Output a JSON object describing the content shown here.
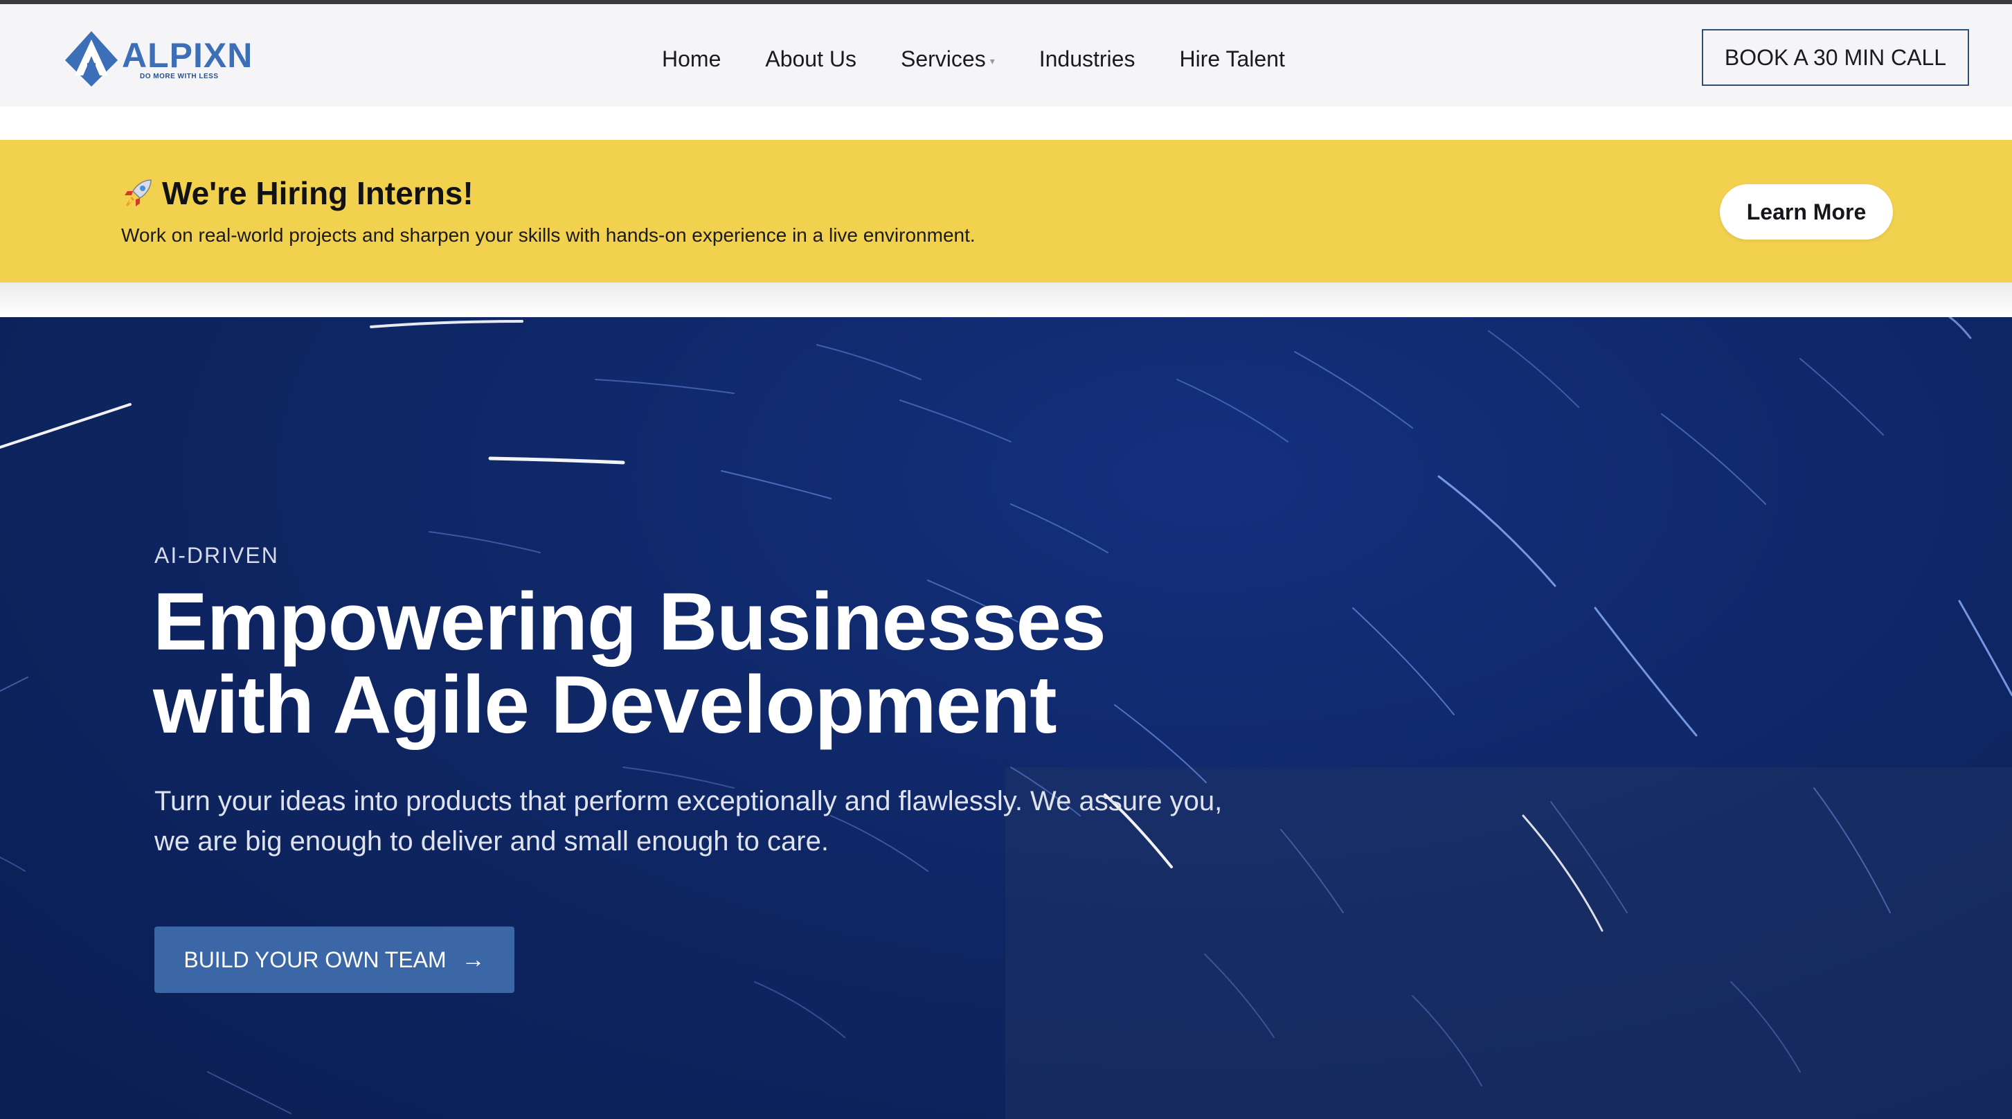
{
  "header": {
    "logo_word": "ALPIXN",
    "logo_tagline": "DO MORE WITH LESS",
    "nav": [
      {
        "label": "Home"
      },
      {
        "label": "About Us"
      },
      {
        "label": "Services",
        "has_dropdown": true
      },
      {
        "label": "Industries"
      },
      {
        "label": "Hire Talent"
      }
    ],
    "book_label": "BOOK A 30 MIN CALL"
  },
  "banner": {
    "icon": "rocket-icon",
    "title": "We're Hiring Interns!",
    "subtitle": "Work on real-world projects and sharpen your skills with hands-on experience in a live environment.",
    "button_label": "Learn More",
    "background_color": "#f2d14f"
  },
  "hero": {
    "eyebrow": "AI-DRIVEN",
    "headline_line1": "Empowering Businesses",
    "headline_line2": "with Agile Development",
    "sub_line1": "Turn your ideas into products that perform exceptionally and flawlessly. We assure you,",
    "sub_line2": "we are big enough to deliver and small enough to care.",
    "cta_label": "BUILD YOUR OWN TEAM",
    "cta_icon": "arrow-right-icon",
    "background_color": "#0f2766",
    "cta_color": "#3b67a6"
  },
  "colors": {
    "brand_blue": "#3d6fb8",
    "nav_text": "#1b1b1f"
  }
}
